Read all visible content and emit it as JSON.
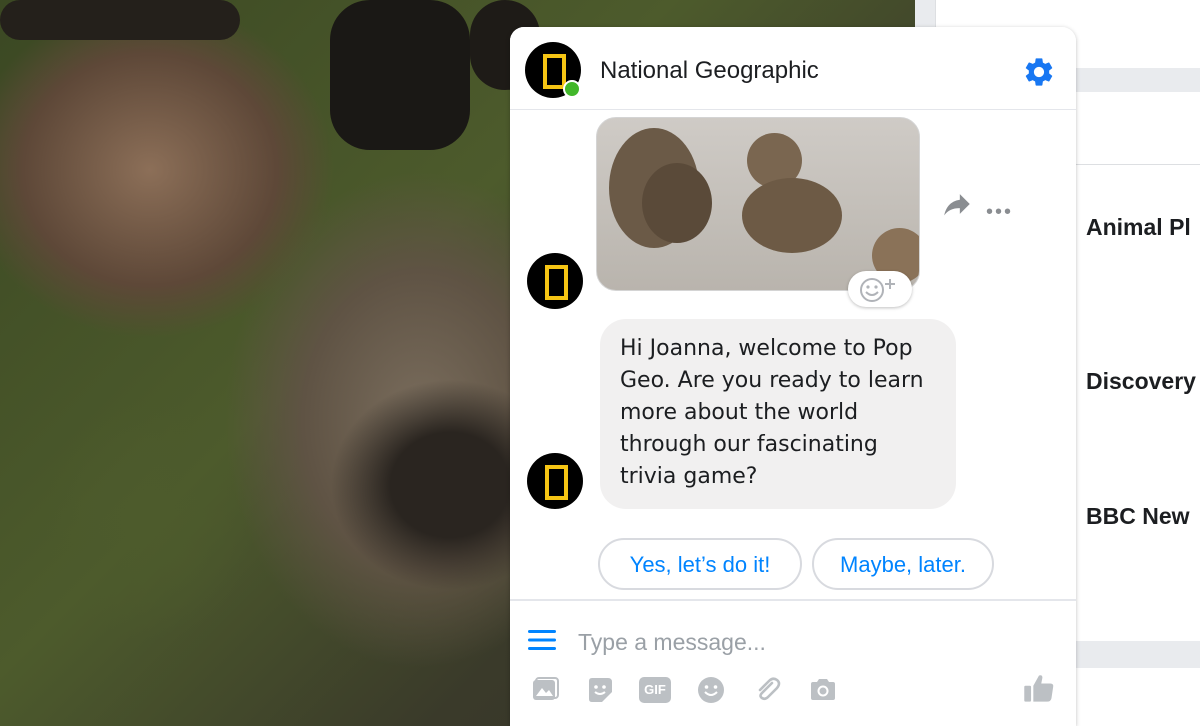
{
  "right_panel": {
    "items": [
      {
        "label": "Animal Pl"
      },
      {
        "label": "Discovery"
      },
      {
        "label": "BBC New"
      }
    ]
  },
  "chat": {
    "title": "National Geographic",
    "status": "online",
    "messages": [
      {
        "type": "image",
        "content": "bears-photo"
      },
      {
        "type": "text",
        "text": "Hi Joanna, welcome to Pop Geo. Are you ready to learn more about the world through our fascinating trivia game?"
      }
    ],
    "quick_replies": [
      {
        "label": "Yes, let’s do it!"
      },
      {
        "label": "Maybe, later."
      }
    ],
    "composer": {
      "placeholder": "Type a message...",
      "tools": [
        "image-icon",
        "sticker-icon",
        "gif-icon",
        "emoji-icon",
        "attachment-icon",
        "camera-icon",
        "like-icon"
      ],
      "gif_label": "GIF"
    }
  },
  "colors": {
    "accent": "#0084ff",
    "gear": "#1877f2",
    "online": "#42b72a",
    "brand_yellow": "#f6c514",
    "tool_gray": "#bcc0c4"
  }
}
